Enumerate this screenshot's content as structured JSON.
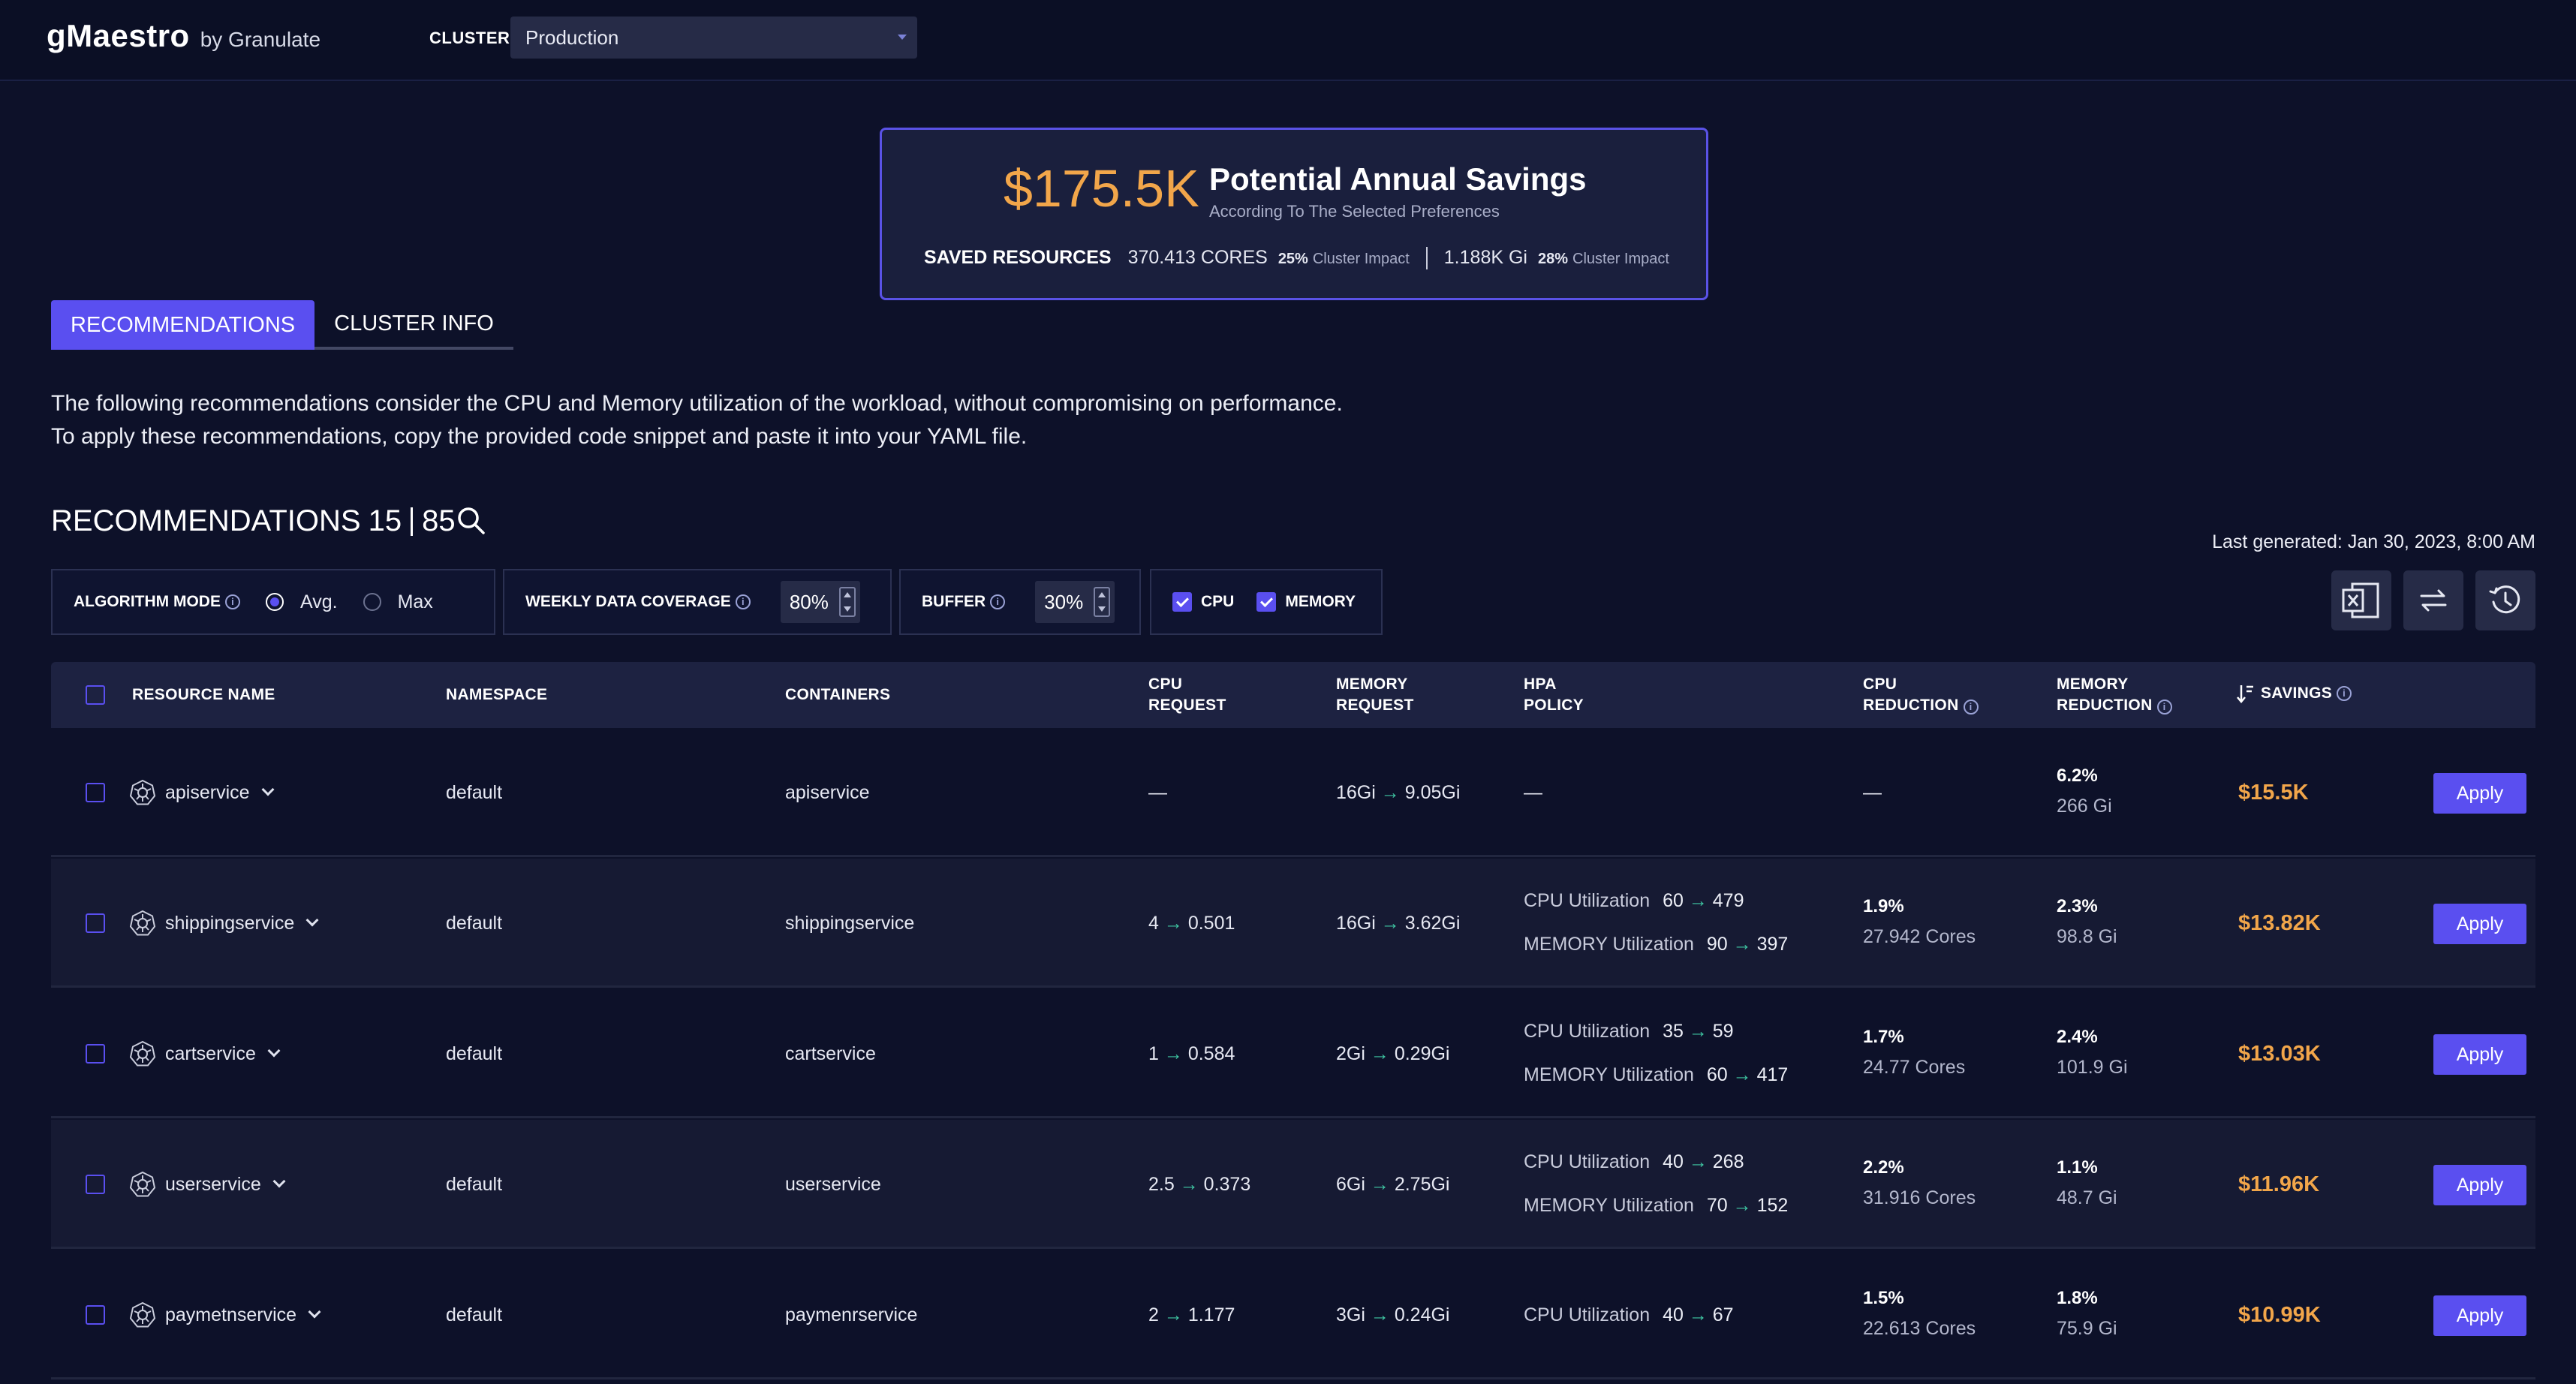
{
  "app": {
    "brand_name": "gMaestro",
    "brand_by": "by Granulate",
    "cluster_label": "CLUSTER",
    "cluster_value": "Production"
  },
  "summary": {
    "amount": "$175.5K",
    "title": "Potential Annual Savings",
    "subtitle": "According To The Selected Preferences",
    "saved_label": "SAVED RESOURCES",
    "cores": "370.413 CORES",
    "cores_pct": "25%",
    "cores_pct_label": "Cluster Impact",
    "memory": "1.188K Gi",
    "memory_pct": "28%",
    "memory_pct_label": "Cluster Impact"
  },
  "tabs": [
    {
      "label": "RECOMMENDATIONS",
      "active": true
    },
    {
      "label": "CLUSTER INFO",
      "active": false
    }
  ],
  "description": {
    "line1": "The following recommendations consider the CPU and Memory utilization of the workload, without compromising on performance.",
    "line2": "To apply these recommendations, copy the provided code snippet and paste it into your YAML file."
  },
  "recommendations": {
    "title": "RECOMMENDATIONS",
    "shown": "15",
    "total": "85",
    "last_generated": "Last generated: Jan 30, 2023, 8:00 AM"
  },
  "controls": {
    "algorithm_label": "ALGORITHM MODE",
    "algo_avg": "Avg.",
    "algo_max": "Max",
    "coverage_label": "WEEKLY DATA COVERAGE",
    "coverage_value": "80%",
    "buffer_label": "BUFFER",
    "buffer_value": "30%",
    "cpu_label": "CPU",
    "memory_label": "MEMORY"
  },
  "table": {
    "headers": {
      "resource": "RESOURCE NAME",
      "namespace": "NAMESPACE",
      "containers": "CONTAINERS",
      "cpu_req_1": "CPU",
      "cpu_req_2": "REQUEST",
      "mem_req_1": "MEMORY",
      "mem_req_2": "REQUEST",
      "hpa_1": "HPA",
      "hpa_2": "POLICY",
      "cpu_red_1": "CPU",
      "cpu_red_2": "REDUCTION",
      "mem_red_1": "MEMORY",
      "mem_red_2": "REDUCTION",
      "savings": "SAVINGS"
    },
    "apply_label": "Apply",
    "rows": [
      {
        "name": "apiservice",
        "namespace": "default",
        "container": "apiservice",
        "cpu_from": "—",
        "cpu_to": "",
        "mem_from": "16Gi",
        "mem_to": "9.05Gi",
        "hpa_cpu_label": "",
        "hpa_cpu_from": "",
        "hpa_cpu_to": "",
        "hpa_mem_label": "",
        "hpa_mem_from": "",
        "hpa_mem_to": "",
        "hpa_dash": "—",
        "cpu_red_pct": "",
        "cpu_red_val": "",
        "cpu_red_dash": "—",
        "mem_red_pct": "6.2%",
        "mem_red_val": "266 Gi",
        "savings": "$15.5K"
      },
      {
        "name": "shippingservice",
        "namespace": "default",
        "container": "shippingservice",
        "cpu_from": "4",
        "cpu_to": "0.501",
        "mem_from": "16Gi",
        "mem_to": "3.62Gi",
        "hpa_cpu_label": "CPU Utilization",
        "hpa_cpu_from": "60",
        "hpa_cpu_to": "479",
        "hpa_mem_label": "MEMORY Utilization",
        "hpa_mem_from": "90",
        "hpa_mem_to": "397",
        "hpa_dash": "",
        "cpu_red_pct": "1.9%",
        "cpu_red_val": "27.942 Cores",
        "cpu_red_dash": "",
        "mem_red_pct": "2.3%",
        "mem_red_val": "98.8 Gi",
        "savings": "$13.82K"
      },
      {
        "name": "cartservice",
        "namespace": "default",
        "container": "cartservice",
        "cpu_from": "1",
        "cpu_to": "0.584",
        "mem_from": "2Gi",
        "mem_to": "0.29Gi",
        "hpa_cpu_label": "CPU Utilization",
        "hpa_cpu_from": "35",
        "hpa_cpu_to": "59",
        "hpa_mem_label": "MEMORY Utilization",
        "hpa_mem_from": "60",
        "hpa_mem_to": "417",
        "hpa_dash": "",
        "cpu_red_pct": "1.7%",
        "cpu_red_val": "24.77 Cores",
        "cpu_red_dash": "",
        "mem_red_pct": "2.4%",
        "mem_red_val": "101.9 Gi",
        "savings": "$13.03K"
      },
      {
        "name": "userservice",
        "namespace": "default",
        "container": "userservice",
        "cpu_from": "2.5",
        "cpu_to": "0.373",
        "mem_from": "6Gi",
        "mem_to": "2.75Gi",
        "hpa_cpu_label": "CPU Utilization",
        "hpa_cpu_from": "40",
        "hpa_cpu_to": "268",
        "hpa_mem_label": "MEMORY Utilization",
        "hpa_mem_from": "70",
        "hpa_mem_to": "152",
        "hpa_dash": "",
        "cpu_red_pct": "2.2%",
        "cpu_red_val": "31.916 Cores",
        "cpu_red_dash": "",
        "mem_red_pct": "1.1%",
        "mem_red_val": "48.7 Gi",
        "savings": "$11.96K"
      },
      {
        "name": "paymetnservice",
        "namespace": "default",
        "container": "paymenrservice",
        "cpu_from": "2",
        "cpu_to": "1.177",
        "mem_from": "3Gi",
        "mem_to": "0.24Gi",
        "hpa_cpu_label": "CPU Utilization",
        "hpa_cpu_from": "40",
        "hpa_cpu_to": "67",
        "hpa_mem_label": "",
        "hpa_mem_from": "",
        "hpa_mem_to": "",
        "hpa_dash": "",
        "cpu_red_pct": "1.5%",
        "cpu_red_val": "22.613 Cores",
        "cpu_red_dash": "",
        "mem_red_pct": "1.8%",
        "mem_red_val": "75.9 Gi",
        "savings": "$10.99K"
      }
    ]
  }
}
